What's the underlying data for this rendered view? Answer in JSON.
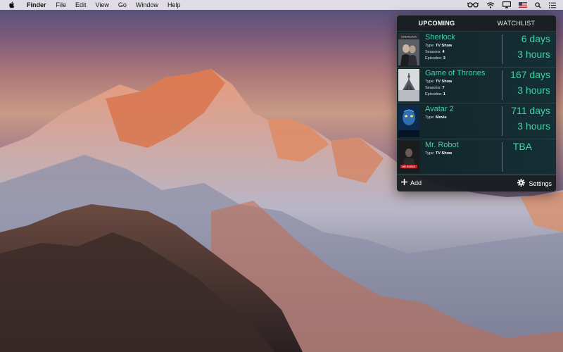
{
  "menubar": {
    "app_name": "Finder",
    "menus": [
      "File",
      "Edit",
      "View",
      "Go",
      "Window",
      "Help"
    ]
  },
  "popover": {
    "tabs": [
      {
        "label": "UPCOMING",
        "active": true
      },
      {
        "label": "WATCHLIST",
        "active": false
      }
    ],
    "items": [
      {
        "title": "Sherlock",
        "type_label": "Type:",
        "type": "TV Show",
        "seasons_label": "Seasons:",
        "seasons": "4",
        "episodes_label": "Episodes:",
        "episodes": "3",
        "countdown_primary": "6 days",
        "countdown_secondary": "3 hours",
        "poster_text": "SHERLOCK"
      },
      {
        "title": "Game of Thrones",
        "type_label": "Type:",
        "type": "TV Show",
        "seasons_label": "Seasons:",
        "seasons": "7",
        "episodes_label": "Episodes:",
        "episodes": "1",
        "countdown_primary": "167 days",
        "countdown_secondary": "3 hours"
      },
      {
        "title": "Avatar 2",
        "type_label": "Type:",
        "type": "Movie",
        "countdown_primary": "711 days",
        "countdown_secondary": "3 hours"
      },
      {
        "title": "Mr. Robot",
        "type_label": "Type:",
        "type": "TV Show",
        "countdown_primary": "TBA",
        "poster_text": "MR ROBOT"
      }
    ],
    "footer": {
      "add_label": "Add",
      "settings_label": "Settings"
    }
  },
  "icons": {
    "status": [
      "glasses-icon",
      "wifi-icon",
      "airplay-icon",
      "flag-icon",
      "spotlight-icon",
      "notification-center-icon"
    ]
  },
  "colors": {
    "accent": "#3fd3a4",
    "popover_bg": "#161c20"
  }
}
